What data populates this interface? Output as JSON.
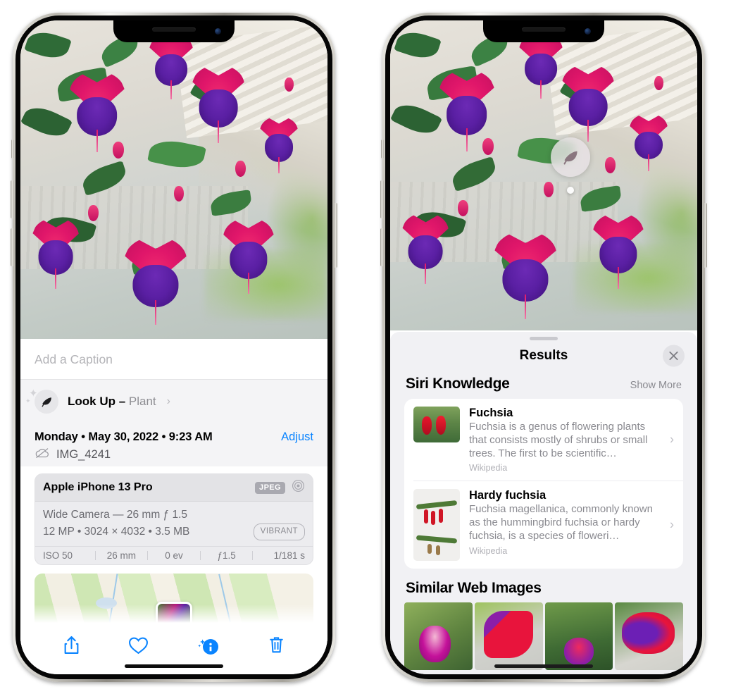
{
  "left_phone": {
    "caption_field": {
      "placeholder": "Add a Caption",
      "value": ""
    },
    "lookup": {
      "label": "Look Up – ",
      "subject": "Plant",
      "chevron": "›",
      "icon": "leaf-icon"
    },
    "meta": {
      "date": "Monday • May 30, 2022 • 9:23 AM",
      "adjust_label": "Adjust",
      "filename": "IMG_4241",
      "cloud_icon": "icloud-slash-icon"
    },
    "camera_card": {
      "device": "Apple iPhone 13 Pro",
      "format_chip": "JPEG",
      "lens_icon": "aperture-icon",
      "lens_line": "Wide Camera — 26 mm ƒ 1.5",
      "spec_line": "12 MP • 3024 × 4032 • 3.5 MB",
      "profile_pill": "VIBRANT",
      "exif": [
        "ISO 50",
        "26 mm",
        "0 ev",
        "ƒ1.5",
        "1/181 s"
      ]
    },
    "toolbar": [
      {
        "name": "share-button",
        "glyph": "share"
      },
      {
        "name": "favorite-button",
        "glyph": "heart"
      },
      {
        "name": "info-button",
        "glyph": "info-sparkle"
      },
      {
        "name": "delete-button",
        "glyph": "trash"
      }
    ]
  },
  "right_phone": {
    "badge": {
      "icon": "leaf-icon",
      "name": "visual-look-up-badge"
    },
    "sheet": {
      "title": "Results",
      "close_icon": "close-icon",
      "siri_section": {
        "title": "Siri Knowledge",
        "action": "Show More"
      },
      "knowledge": [
        {
          "title": "Fuchsia",
          "desc": "Fuchsia is a genus of flowering plants that consists mostly of shrubs or small trees. The first to be scientific…",
          "source": "Wikipedia",
          "thumb": "fuchsia-red-flowers-thumb"
        },
        {
          "title": "Hardy fuchsia",
          "desc": "Fuchsia magellanica, commonly known as the hummingbird fuchsia or hardy fuchsia, is a species of floweri…",
          "source": "Wikipedia",
          "thumb": "hardy-fuchsia-specimen-thumb"
        }
      ],
      "web_section": {
        "title": "Similar Web Images"
      },
      "web_images": [
        {
          "alt": "pink-white-fuchsia-bloom"
        },
        {
          "alt": "red-purple-fuchsia-closeup"
        },
        {
          "alt": "fuchsia-shrub-buds"
        },
        {
          "alt": "purple-red-double-fuchsia"
        }
      ]
    }
  },
  "colors": {
    "accent_blue": "#0a84ff",
    "sheet_gray": "#f1f1f4",
    "card_white": "#ffffff",
    "secondary_text": "#8a8a90"
  }
}
